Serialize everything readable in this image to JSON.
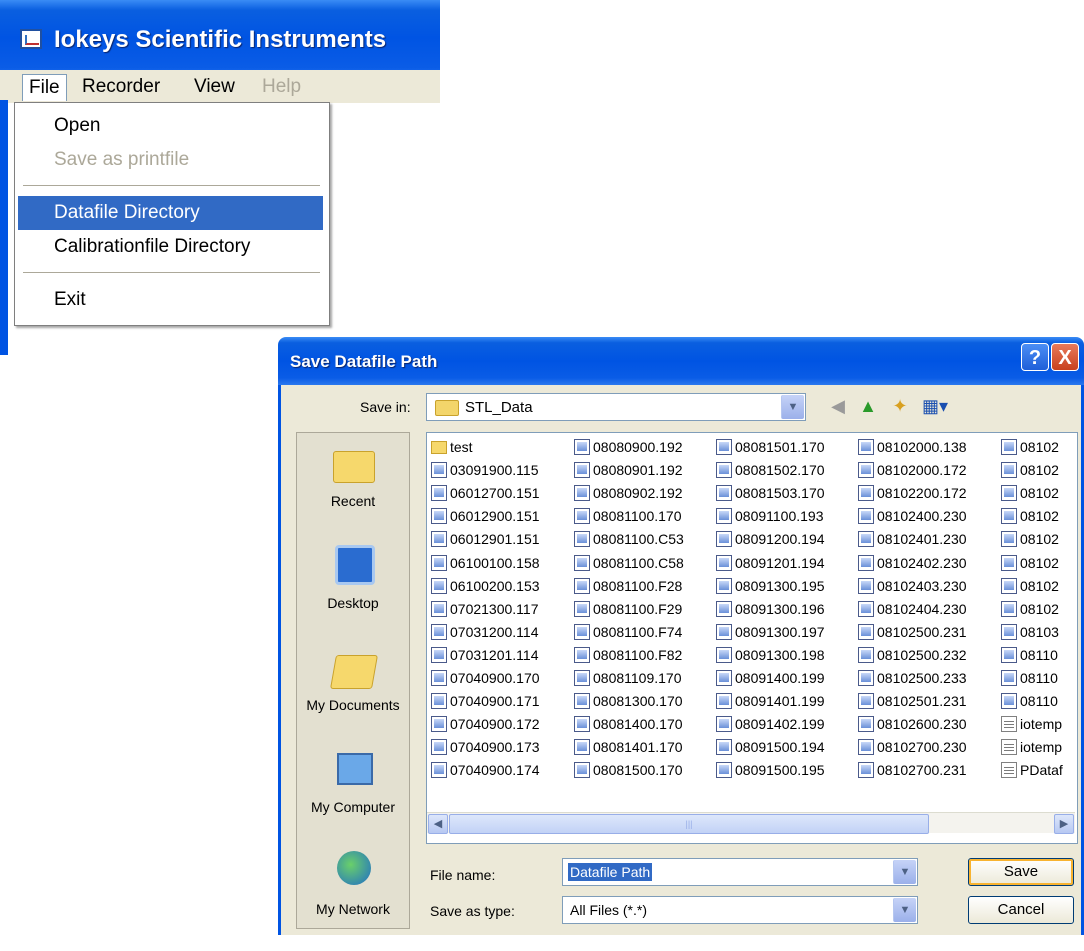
{
  "app": {
    "title": "Iokeys Scientific Instruments",
    "menus": [
      "File",
      "Recorder",
      "View",
      "Help"
    ],
    "file_menu_items": [
      "Open",
      "Save as printfile",
      "Datafile Directory",
      "Calibrationfile Directory",
      "Exit"
    ]
  },
  "dialog": {
    "title": "Save Datafile Path",
    "help_glyph": "?",
    "close_glyph": "X",
    "save_in_label": "Save in:",
    "save_in_value": "STL_Data",
    "places": [
      "Recent",
      "Desktop",
      "My Documents",
      "My Computer",
      "My Network"
    ],
    "columns": [
      [
        "test",
        "03091900.115",
        "06012700.151",
        "06012900.151",
        "06012901.151",
        "06100100.158",
        "06100200.153",
        "07021300.117",
        "07031200.114",
        "07031201.114",
        "07040900.170",
        "07040900.171",
        "07040900.172",
        "07040900.173",
        "07040900.174"
      ],
      [
        "08080900.192",
        "08080901.192",
        "08080902.192",
        "08081100.170",
        "08081100.C53",
        "08081100.C58",
        "08081100.F28",
        "08081100.F29",
        "08081100.F74",
        "08081100.F82",
        "08081109.170",
        "08081300.170",
        "08081400.170",
        "08081401.170",
        "08081500.170"
      ],
      [
        "08081501.170",
        "08081502.170",
        "08081503.170",
        "08091100.193",
        "08091200.194",
        "08091201.194",
        "08091300.195",
        "08091300.196",
        "08091300.197",
        "08091300.198",
        "08091400.199",
        "08091401.199",
        "08091402.199",
        "08091500.194",
        "08091500.195"
      ],
      [
        "08102000.138",
        "08102000.172",
        "08102200.172",
        "08102400.230",
        "08102401.230",
        "08102402.230",
        "08102403.230",
        "08102404.230",
        "08102500.231",
        "08102500.232",
        "08102500.233",
        "08102501.231",
        "08102600.230",
        "08102700.230",
        "08102700.231"
      ],
      [
        "08102",
        "08102",
        "08102",
        "08102",
        "08102",
        "08102",
        "08102",
        "08102",
        "08103",
        "08110",
        "08110",
        "08110",
        "iotemp",
        "iotemp",
        "PDataf"
      ]
    ],
    "file_name_label": "File name:",
    "file_name_value": "Datafile Path",
    "save_type_label": "Save as type:",
    "save_type_value": "All Files (*.*)",
    "save_button": "Save",
    "cancel_button": "Cancel"
  }
}
